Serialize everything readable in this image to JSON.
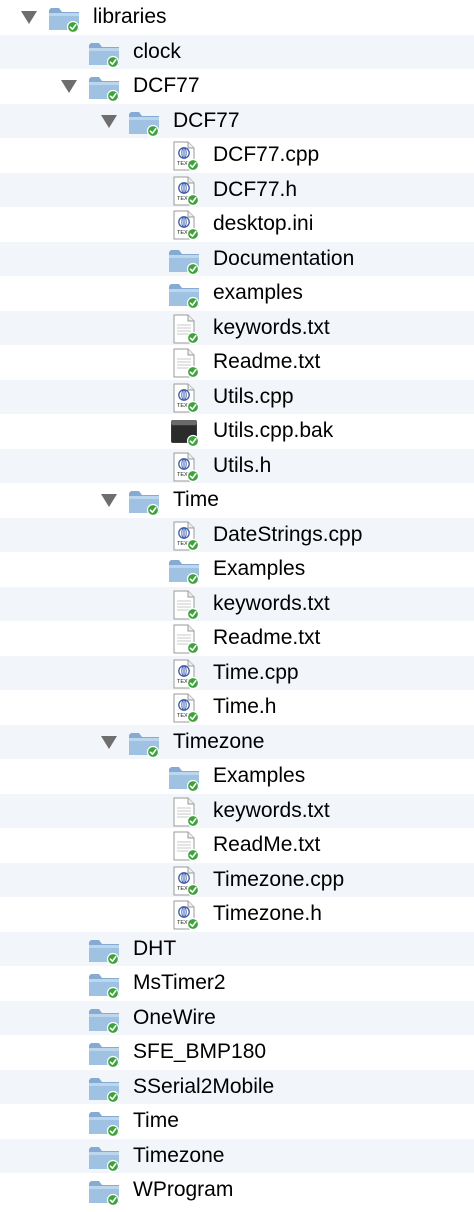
{
  "tree": [
    {
      "label": "libraries",
      "kind": "folder",
      "depth": 0,
      "expanded": true
    },
    {
      "label": "clock",
      "kind": "folder",
      "depth": 1,
      "expanded": false
    },
    {
      "label": "DCF77",
      "kind": "folder",
      "depth": 1,
      "expanded": true
    },
    {
      "label": "DCF77",
      "kind": "folder",
      "depth": 2,
      "expanded": true
    },
    {
      "label": "DCF77.cpp",
      "kind": "source",
      "depth": 3
    },
    {
      "label": "DCF77.h",
      "kind": "source",
      "depth": 3
    },
    {
      "label": "desktop.ini",
      "kind": "source",
      "depth": 3
    },
    {
      "label": "Documentation",
      "kind": "folder",
      "depth": 3,
      "expanded": false
    },
    {
      "label": "examples",
      "kind": "folder",
      "depth": 3,
      "expanded": false
    },
    {
      "label": "keywords.txt",
      "kind": "text",
      "depth": 3
    },
    {
      "label": "Readme.txt",
      "kind": "text",
      "depth": 3
    },
    {
      "label": "Utils.cpp",
      "kind": "source",
      "depth": 3
    },
    {
      "label": "Utils.cpp.bak",
      "kind": "binary",
      "depth": 3
    },
    {
      "label": "Utils.h",
      "kind": "source",
      "depth": 3
    },
    {
      "label": "Time",
      "kind": "folder",
      "depth": 2,
      "expanded": true
    },
    {
      "label": "DateStrings.cpp",
      "kind": "source",
      "depth": 3
    },
    {
      "label": "Examples",
      "kind": "folder",
      "depth": 3,
      "expanded": false
    },
    {
      "label": "keywords.txt",
      "kind": "text",
      "depth": 3
    },
    {
      "label": "Readme.txt",
      "kind": "text",
      "depth": 3
    },
    {
      "label": "Time.cpp",
      "kind": "source",
      "depth": 3
    },
    {
      "label": "Time.h",
      "kind": "source",
      "depth": 3
    },
    {
      "label": "Timezone",
      "kind": "folder",
      "depth": 2,
      "expanded": true
    },
    {
      "label": "Examples",
      "kind": "folder",
      "depth": 3,
      "expanded": false
    },
    {
      "label": "keywords.txt",
      "kind": "text",
      "depth": 3
    },
    {
      "label": "ReadMe.txt",
      "kind": "text",
      "depth": 3
    },
    {
      "label": "Timezone.cpp",
      "kind": "source",
      "depth": 3
    },
    {
      "label": "Timezone.h",
      "kind": "source",
      "depth": 3
    },
    {
      "label": "DHT",
      "kind": "folder",
      "depth": 1,
      "expanded": false
    },
    {
      "label": "MsTimer2",
      "kind": "folder",
      "depth": 1,
      "expanded": false
    },
    {
      "label": "OneWire",
      "kind": "folder",
      "depth": 1,
      "expanded": false
    },
    {
      "label": "SFE_BMP180",
      "kind": "folder",
      "depth": 1,
      "expanded": false
    },
    {
      "label": "SSerial2Mobile",
      "kind": "folder",
      "depth": 1,
      "expanded": false
    },
    {
      "label": "Time",
      "kind": "folder",
      "depth": 1,
      "expanded": false
    },
    {
      "label": "Timezone",
      "kind": "folder",
      "depth": 1,
      "expanded": false
    },
    {
      "label": "WProgram",
      "kind": "folder",
      "depth": 1,
      "expanded": false
    }
  ],
  "icon_text": {
    "source": "TEXT"
  },
  "colors": {
    "folder": "#9fc1e2",
    "folder_tab": "#86abd2",
    "sync_badge": "#3ea33a",
    "disclosure": "#6e6e6e",
    "stripe": "#f2f5fa"
  }
}
